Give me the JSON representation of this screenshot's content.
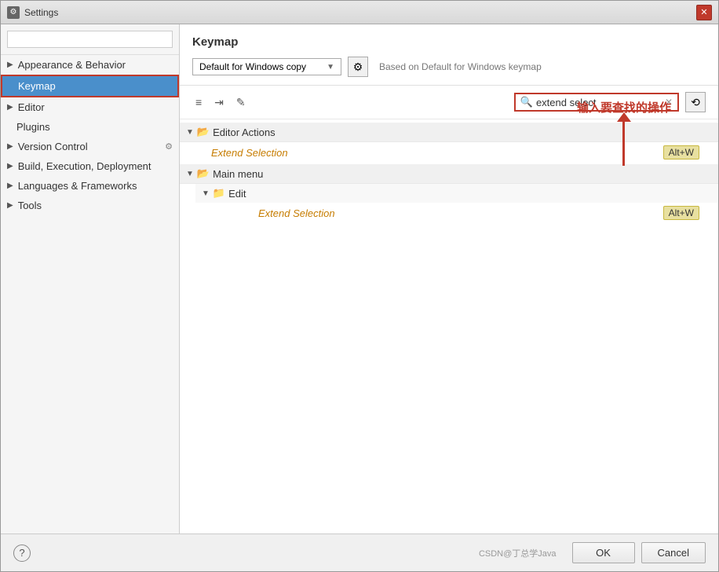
{
  "window": {
    "title": "Settings",
    "title_icon": "⚙"
  },
  "sidebar": {
    "search_placeholder": "",
    "items": [
      {
        "id": "appearance",
        "label": "Appearance & Behavior",
        "has_arrow": true,
        "active": false
      },
      {
        "id": "keymap",
        "label": "Keymap",
        "has_arrow": false,
        "active": true
      },
      {
        "id": "editor",
        "label": "Editor",
        "has_arrow": true,
        "active": false
      },
      {
        "id": "plugins",
        "label": "Plugins",
        "has_arrow": false,
        "active": false
      },
      {
        "id": "version-control",
        "label": "Version Control",
        "has_arrow": true,
        "active": false
      },
      {
        "id": "build",
        "label": "Build, Execution, Deployment",
        "has_arrow": true,
        "active": false
      },
      {
        "id": "languages",
        "label": "Languages & Frameworks",
        "has_arrow": true,
        "active": false
      },
      {
        "id": "tools",
        "label": "Tools",
        "has_arrow": true,
        "active": false
      }
    ]
  },
  "main": {
    "title": "Keymap",
    "keymap_dropdown": "Default for Windows copy",
    "based_on": "Based on Default for Windows keymap",
    "search_value": "extend select",
    "search_placeholder": "extend select",
    "tree": [
      {
        "id": "editor-actions",
        "name": "Editor Actions",
        "expanded": true,
        "items": [
          {
            "name": "Extend Selection",
            "shortcut": "Alt+W"
          }
        ]
      },
      {
        "id": "main-menu",
        "name": "Main menu",
        "expanded": true,
        "sub_groups": [
          {
            "name": "Edit",
            "expanded": true,
            "items": [
              {
                "name": "Extend Selection",
                "shortcut": "Alt+W"
              }
            ]
          }
        ]
      }
    ]
  },
  "annotation": {
    "text": "输入要查找的操作"
  },
  "bottom": {
    "ok_label": "OK",
    "cancel_label": "Cancel",
    "watermark": "CSDN@丁总学Java"
  },
  "icons": {
    "expand": "▼",
    "collapse": "▶",
    "folder": "📁",
    "gear": "⚙",
    "search": "🔍",
    "pencil": "✎",
    "list": "≡",
    "indent": "⇥",
    "history": "⟲",
    "help": "?",
    "close_x": "✕"
  }
}
